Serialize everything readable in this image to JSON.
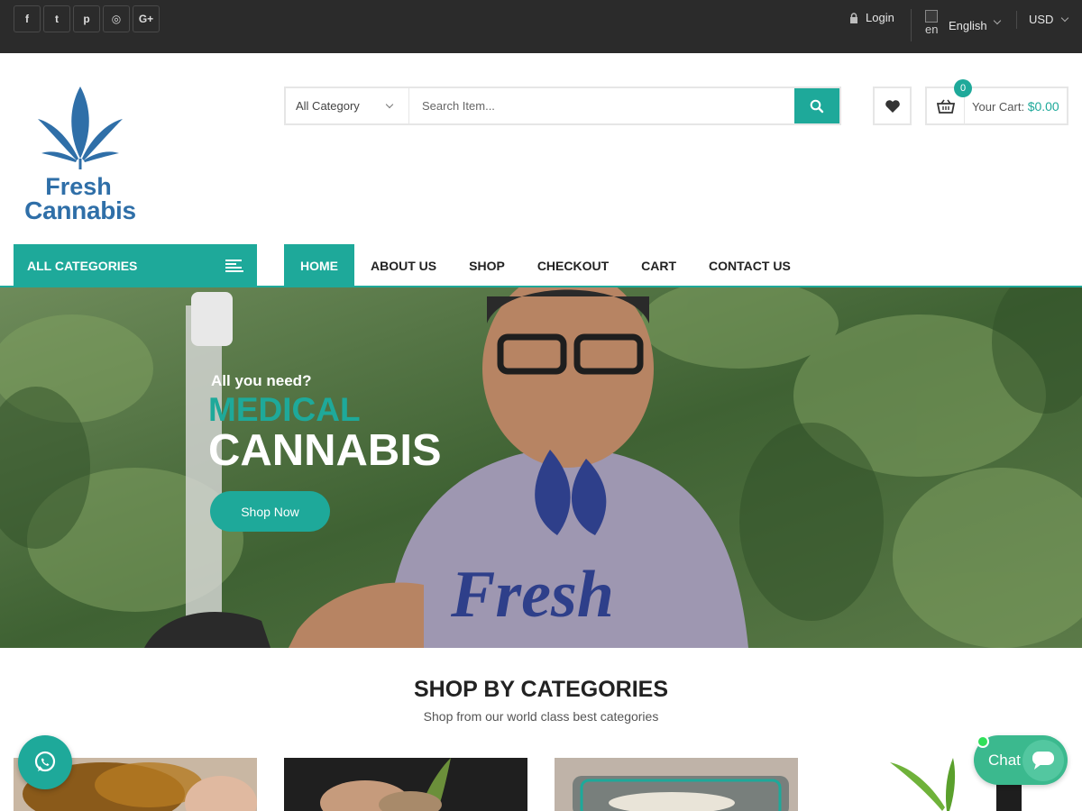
{
  "topbar": {
    "social": [
      {
        "icon": "facebook-icon",
        "glyph": "f"
      },
      {
        "icon": "twitter-icon",
        "glyph": "t"
      },
      {
        "icon": "pinterest-icon",
        "glyph": "p"
      },
      {
        "icon": "instagram-icon",
        "glyph": "◎"
      },
      {
        "icon": "google-plus-icon",
        "glyph": "G+"
      }
    ],
    "login_label": "Login",
    "language_flag_alt": "en",
    "language_label": "English",
    "currency_label": "USD"
  },
  "logo": {
    "line1": "Fresh",
    "line2": "Cannabis",
    "color": "#2f6fa8"
  },
  "search": {
    "category_label": "All Category",
    "placeholder": "Search Item..."
  },
  "cart": {
    "count": "0",
    "label": "Your Cart:",
    "amount": "$0.00"
  },
  "nav": {
    "all_categories": "ALL CATEGORIES",
    "items": [
      "HOME",
      "ABOUT US",
      "SHOP",
      "CHECKOUT",
      "CART",
      "CONTACT US"
    ],
    "active_index": 0
  },
  "hero": {
    "subtitle": "All you need?",
    "title_line1": "MEDICAL",
    "title_line2": "CANNABIS",
    "button_label": "Shop Now",
    "shirt_text": "Fresh"
  },
  "categories": {
    "title": "SHOP BY CATEGORIES",
    "subtitle": "Shop from our world class best categories"
  },
  "chat": {
    "label": "Chat"
  },
  "colors": {
    "accent": "#1ea99a",
    "topbar": "#2b2b2b",
    "chat": "#3bb98e",
    "online": "#30e05a"
  }
}
